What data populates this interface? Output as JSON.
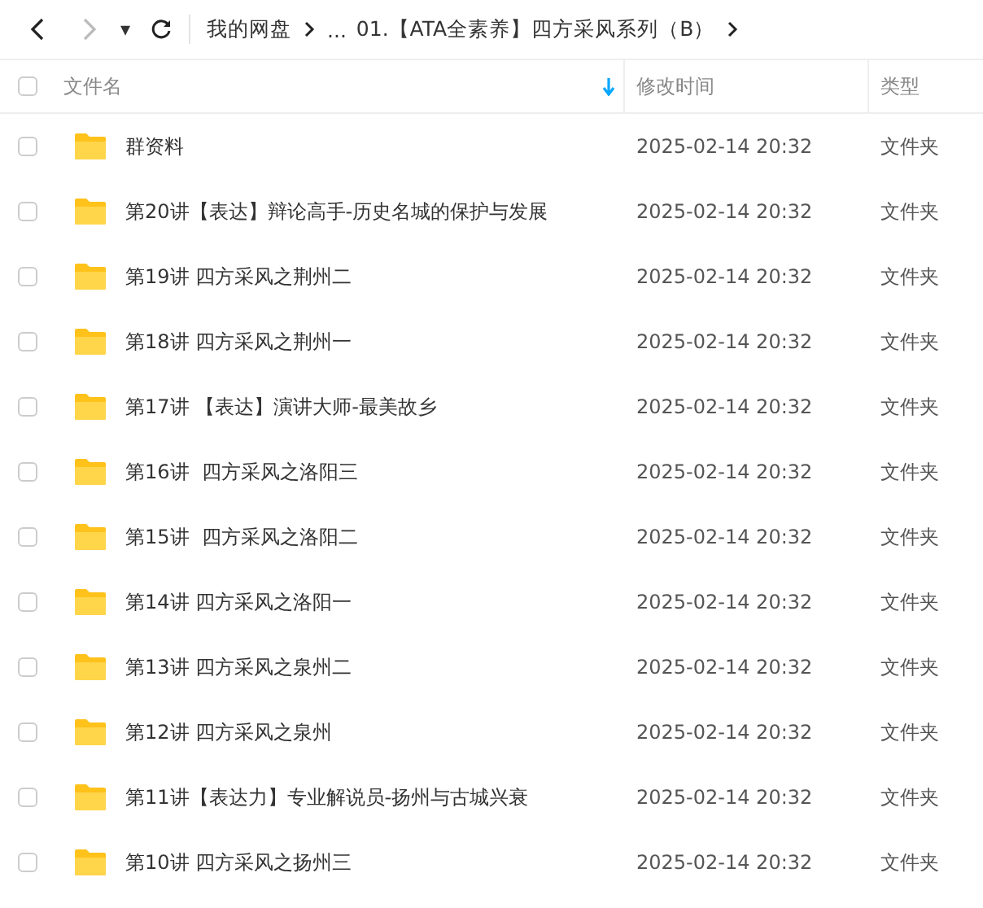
{
  "toolbar": {
    "dropdown_glyph": "▾"
  },
  "breadcrumb": {
    "items": [
      "我的网盘",
      "...",
      "01.【ATA全素养】四方采风系列（B）"
    ]
  },
  "table": {
    "columns": [
      {
        "label": "文件名",
        "sorted": true
      },
      {
        "label": "修改时间",
        "sorted": false
      },
      {
        "label": "类型",
        "sorted": false
      }
    ],
    "select_all": {
      "checked": false
    },
    "rows": [
      {
        "name": "群资料",
        "modified": "2025-02-14 20:32",
        "type": "文件夹",
        "checked": false
      },
      {
        "name": "第20讲【表达】辩论高手-历史名城的保护与发展",
        "modified": "2025-02-14 20:32",
        "type": "文件夹",
        "checked": false
      },
      {
        "name": "第19讲 四方采风之荆州二",
        "modified": "2025-02-14 20:32",
        "type": "文件夹",
        "checked": false
      },
      {
        "name": "第18讲 四方采风之荆州一",
        "modified": "2025-02-14 20:32",
        "type": "文件夹",
        "checked": false
      },
      {
        "name": "第17讲 【表达】演讲大师-最美故乡",
        "modified": "2025-02-14 20:32",
        "type": "文件夹",
        "checked": false
      },
      {
        "name": "第16讲  四方采风之洛阳三",
        "modified": "2025-02-14 20:32",
        "type": "文件夹",
        "checked": false
      },
      {
        "name": "第15讲  四方采风之洛阳二",
        "modified": "2025-02-14 20:32",
        "type": "文件夹",
        "checked": false
      },
      {
        "name": "第14讲 四方采风之洛阳一",
        "modified": "2025-02-14 20:32",
        "type": "文件夹",
        "checked": false
      },
      {
        "name": "第13讲 四方采风之泉州二",
        "modified": "2025-02-14 20:32",
        "type": "文件夹",
        "checked": false
      },
      {
        "name": "第12讲 四方采风之泉州",
        "modified": "2025-02-14 20:32",
        "type": "文件夹",
        "checked": false
      },
      {
        "name": "第11讲【表达力】专业解说员-扬州与古城兴衰",
        "modified": "2025-02-14 20:32",
        "type": "文件夹",
        "checked": false
      },
      {
        "name": "第10讲 四方采风之扬州三",
        "modified": "2025-02-14 20:32",
        "type": "文件夹",
        "checked": false
      }
    ]
  }
}
